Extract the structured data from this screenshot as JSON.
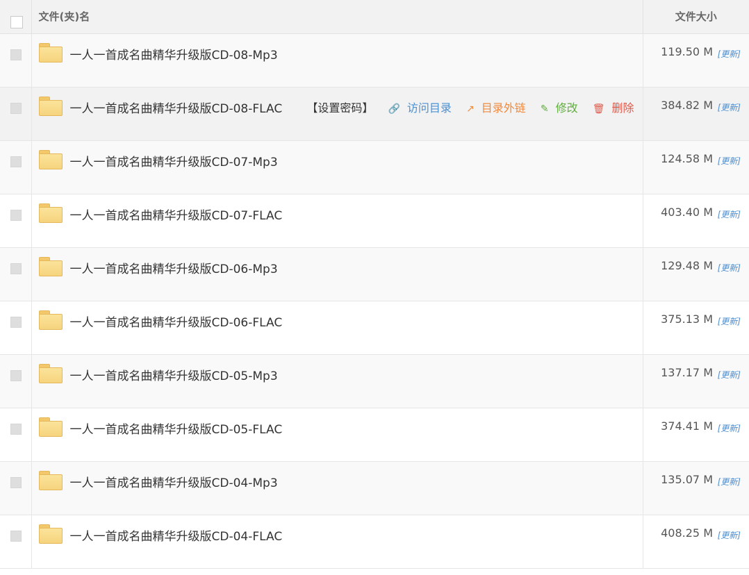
{
  "header": {
    "name_label": "文件(夹)名",
    "size_label": "文件大小"
  },
  "actions": {
    "set_password": "【设置密码】",
    "visit_dir": "访问目录",
    "dir_extlink": "目录外链",
    "edit": "修改",
    "delete": "删除"
  },
  "icons": {
    "folder": "folder-icon",
    "link": "link-icon",
    "share": "share-icon",
    "edit": "edit-icon",
    "trash": "trash-icon"
  },
  "update_label": "[更新]",
  "rows": [
    {
      "name": "一人一首成名曲精华升级版CD-08-Mp3",
      "size": "119.50 M"
    },
    {
      "name": "一人一首成名曲精华升级版CD-08-FLAC",
      "size": "384.82 M"
    },
    {
      "name": "一人一首成名曲精华升级版CD-07-Mp3",
      "size": "124.58 M"
    },
    {
      "name": "一人一首成名曲精华升级版CD-07-FLAC",
      "size": "403.40 M"
    },
    {
      "name": "一人一首成名曲精华升级版CD-06-Mp3",
      "size": "129.48 M"
    },
    {
      "name": "一人一首成名曲精华升级版CD-06-FLAC",
      "size": "375.13 M"
    },
    {
      "name": "一人一首成名曲精华升级版CD-05-Mp3",
      "size": "137.17 M"
    },
    {
      "name": "一人一首成名曲精华升级版CD-05-FLAC",
      "size": "374.41 M"
    },
    {
      "name": "一人一首成名曲精华升级版CD-04-Mp3",
      "size": "135.07 M"
    },
    {
      "name": "一人一首成名曲精华升级版CD-04-FLAC",
      "size": "408.25 M"
    }
  ]
}
